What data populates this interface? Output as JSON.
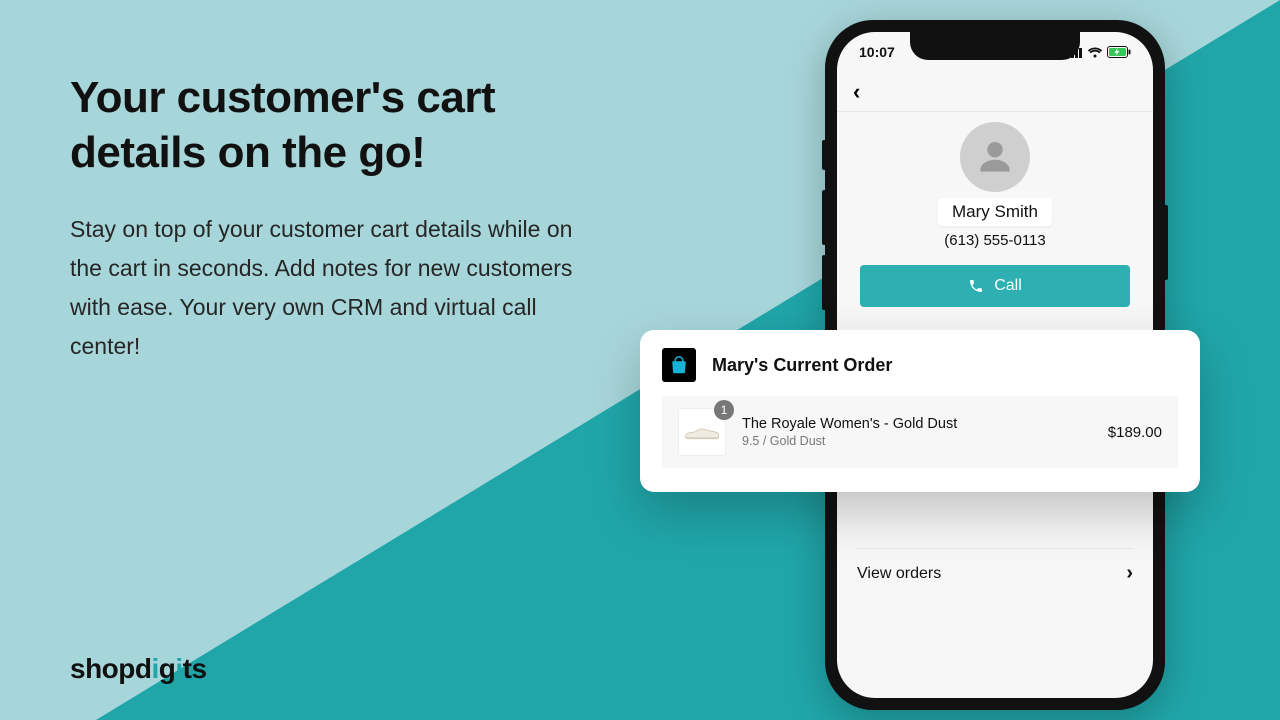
{
  "headline": "Your customer's cart details on the go!",
  "body": "Stay on top of your customer cart details while on the cart in seconds. Add notes for new customers with ease. Your very own CRM and virtual call center!",
  "logo": {
    "pre": "shopd",
    "accent": "i",
    "mid": "g",
    "accent2": "i",
    "post": "ts"
  },
  "status": {
    "time": "10:07"
  },
  "customer": {
    "name": "Mary Smith",
    "phone": "(613) 555-0113"
  },
  "call_label": "Call",
  "card": {
    "title": "Mary's Current Order",
    "item": {
      "qty": "1",
      "name": "The Royale Women's - Gold Dust",
      "variant": "9.5 / Gold Dust",
      "price": "$189.00"
    }
  },
  "view_orders": "View orders"
}
